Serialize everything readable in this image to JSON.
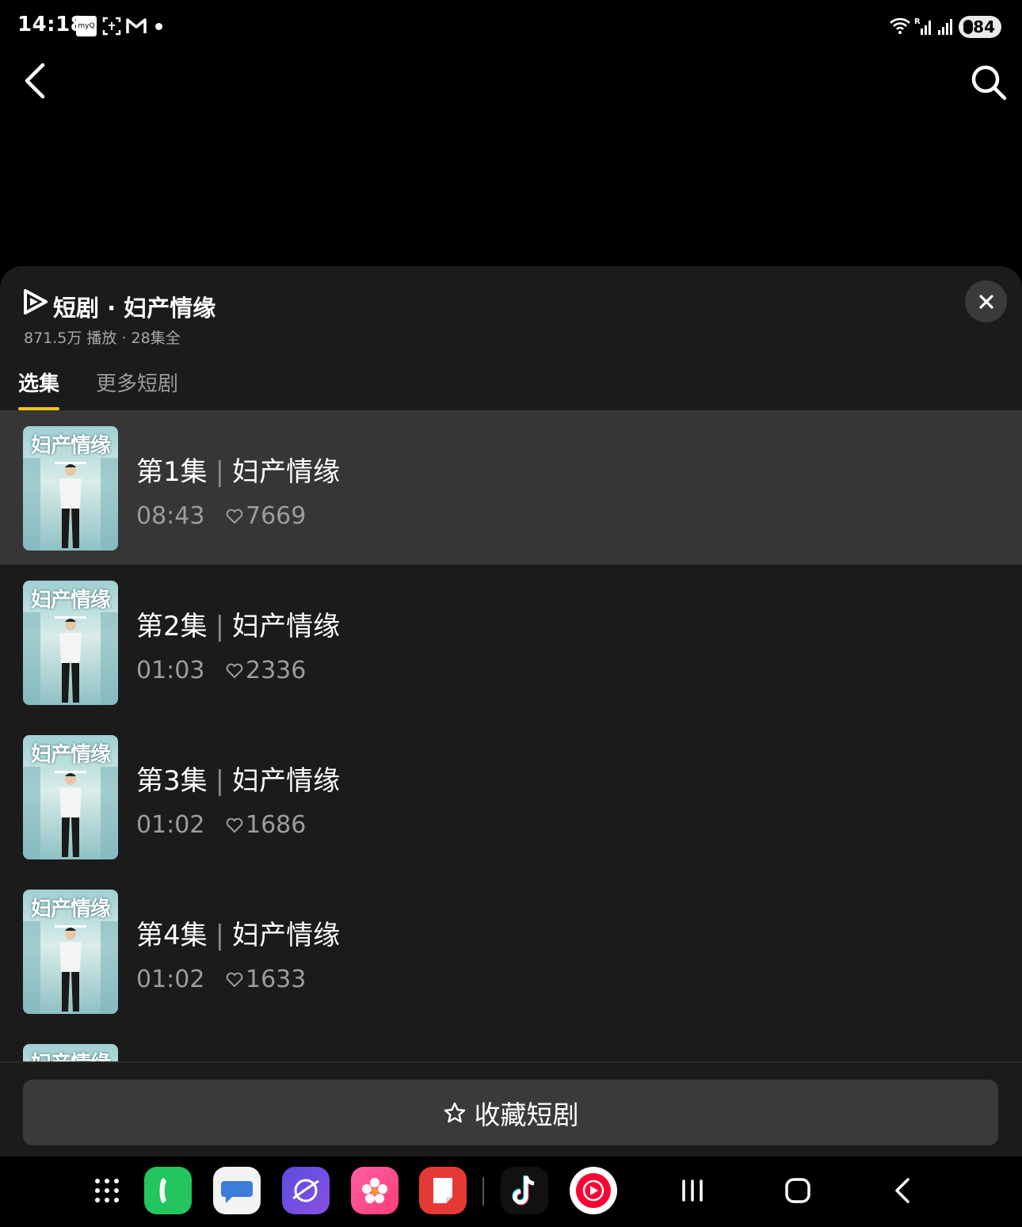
{
  "status_bar": {
    "time": "14:18",
    "myq_label": "myQ",
    "battery": "84",
    "icons": [
      "myq-icon",
      "screenshot-icon",
      "gmail-icon",
      "notification-dot",
      "wifi-icon",
      "signal-r-icon",
      "signal-icon",
      "battery-icon"
    ]
  },
  "top_nav": {
    "back_icon": "chevron-left-icon",
    "search_icon": "search-icon"
  },
  "sheet": {
    "title": "短剧 · 妇产情缘",
    "subtitle": "871.5万 播放 · 28集全",
    "close_icon": "close-icon",
    "tabs": [
      {
        "label": "选集",
        "active": true
      },
      {
        "label": "更多短剧",
        "active": false
      }
    ],
    "episodes": [
      {
        "thumb_title": "妇产情缘",
        "title_ep": "第1集",
        "title_name": "妇产情缘",
        "sep": "|",
        "duration": "08:43",
        "likes": "7669",
        "selected": true
      },
      {
        "thumb_title": "妇产情缘",
        "title_ep": "第2集",
        "title_name": "妇产情缘",
        "sep": "|",
        "duration": "01:03",
        "likes": "2336",
        "selected": false
      },
      {
        "thumb_title": "妇产情缘",
        "title_ep": "第3集",
        "title_name": "妇产情缘",
        "sep": "|",
        "duration": "01:02",
        "likes": "1686",
        "selected": false
      },
      {
        "thumb_title": "妇产情缘",
        "title_ep": "第4集",
        "title_name": "妇产情缘",
        "sep": "|",
        "duration": "01:02",
        "likes": "1633",
        "selected": false
      },
      {
        "thumb_title": "妇产情缘",
        "title_ep": "",
        "title_name": "",
        "sep": "",
        "duration": "",
        "likes": "",
        "selected": false
      }
    ],
    "favorite_button": "收藏短剧"
  },
  "navbar": {
    "apps": [
      "app-drawer-icon",
      "phone-app-icon",
      "messages-app-icon",
      "internet-app-icon",
      "gallery-app-icon",
      "notes-app-icon",
      "tiktok-app-icon",
      "youtube-music-app-icon"
    ],
    "system": [
      "recents-button",
      "home-button",
      "back-button"
    ]
  },
  "colors": {
    "accent": "#f5c518",
    "sheet_bg": "#1b1b1b",
    "selected_row": "#363636",
    "button_bg": "#3a3a3a"
  }
}
